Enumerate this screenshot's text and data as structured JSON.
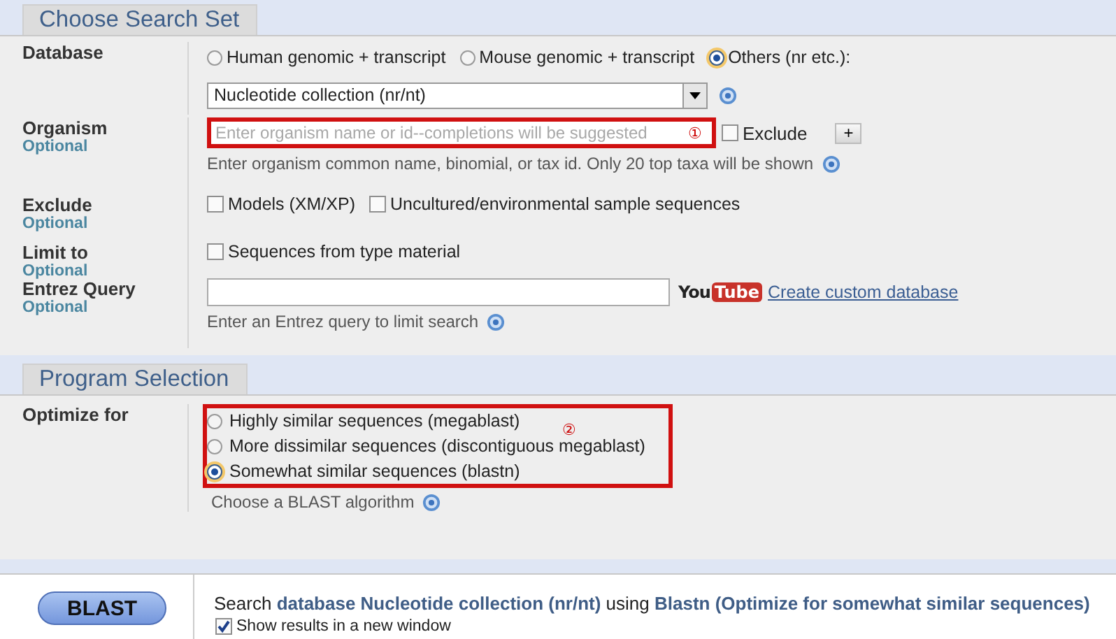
{
  "search_set": {
    "title": "Choose Search Set",
    "database": {
      "label": "Database",
      "options": [
        {
          "label": "Human genomic + transcript",
          "selected": false
        },
        {
          "label": "Mouse genomic + transcript",
          "selected": false
        },
        {
          "label": "Others (nr etc.):",
          "selected": true
        }
      ],
      "select_value": "Nucleotide collection (nr/nt)"
    },
    "organism": {
      "label": "Organism",
      "optional": "Optional",
      "placeholder": "Enter organism name or id--completions will be suggested",
      "annotation": "①",
      "exclude": {
        "label": "Exclude",
        "checked": false
      },
      "add_button": "+",
      "hint": "Enter organism common name, binomial, or tax id. Only 20 top taxa will be shown"
    },
    "exclude": {
      "label": "Exclude",
      "optional": "Optional",
      "options": [
        {
          "label": "Models (XM/XP)",
          "checked": false
        },
        {
          "label": "Uncultured/environmental sample sequences",
          "checked": false
        }
      ]
    },
    "limit_to": {
      "label": "Limit to",
      "optional": "Optional",
      "options": [
        {
          "label": "Sequences from type material",
          "checked": false
        }
      ]
    },
    "entrez_query": {
      "label": "Entrez Query",
      "optional": "Optional",
      "logo_you": "You",
      "logo_tube": "Tube",
      "link": "Create custom database",
      "hint": "Enter an Entrez query to limit search"
    }
  },
  "program_selection": {
    "title": "Program Selection",
    "label": "Optimize for",
    "annotation": "②",
    "options": [
      {
        "label": "Highly similar sequences (megablast)",
        "selected": false
      },
      {
        "label": "More dissimilar sequences (discontiguous megablast)",
        "selected": false
      },
      {
        "label": "Somewhat similar sequences (blastn)",
        "selected": true
      }
    ],
    "hint": "Choose a BLAST algorithm"
  },
  "submit": {
    "button": "BLAST",
    "summary": "Search **database Nucleotide collection (nr/nt)** using **Blastn (Optimize for somewhat similar sequences)**",
    "new_window": {
      "label": "Show results in a new window",
      "checked": true
    }
  }
}
